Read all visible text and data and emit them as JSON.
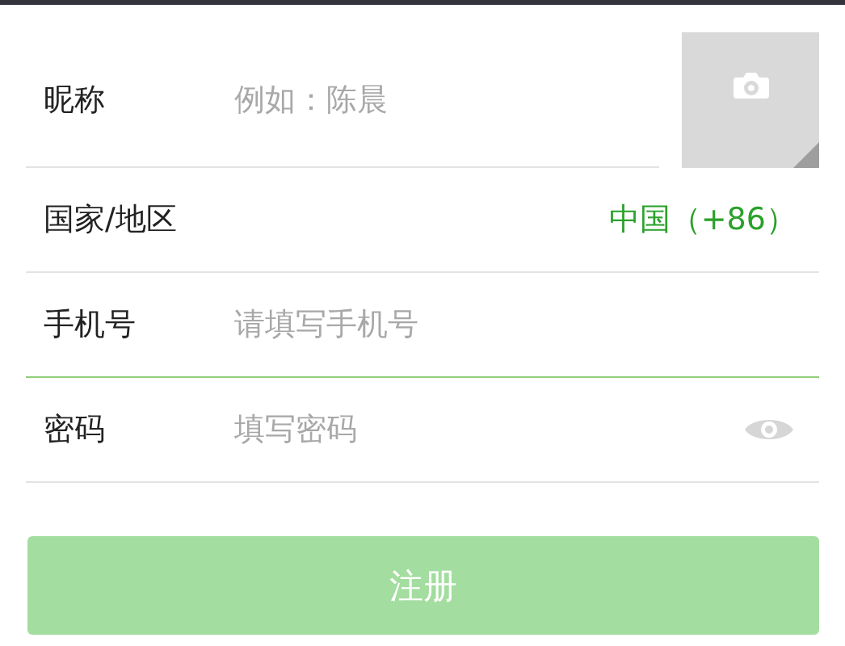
{
  "rows": [
    {
      "kind": "input",
      "label": "昵称",
      "placeholder": "例如：陈晨",
      "focused": false
    },
    {
      "kind": "select",
      "label": "国家/地区",
      "value": "中国（+86）",
      "focused": false
    },
    {
      "kind": "input",
      "label": "手机号",
      "placeholder": "请填写手机号",
      "focused": true
    },
    {
      "kind": "password",
      "label": "密码",
      "placeholder": "填写密码",
      "focused": false
    }
  ],
  "button": {
    "label": "注册",
    "disabled": true
  }
}
